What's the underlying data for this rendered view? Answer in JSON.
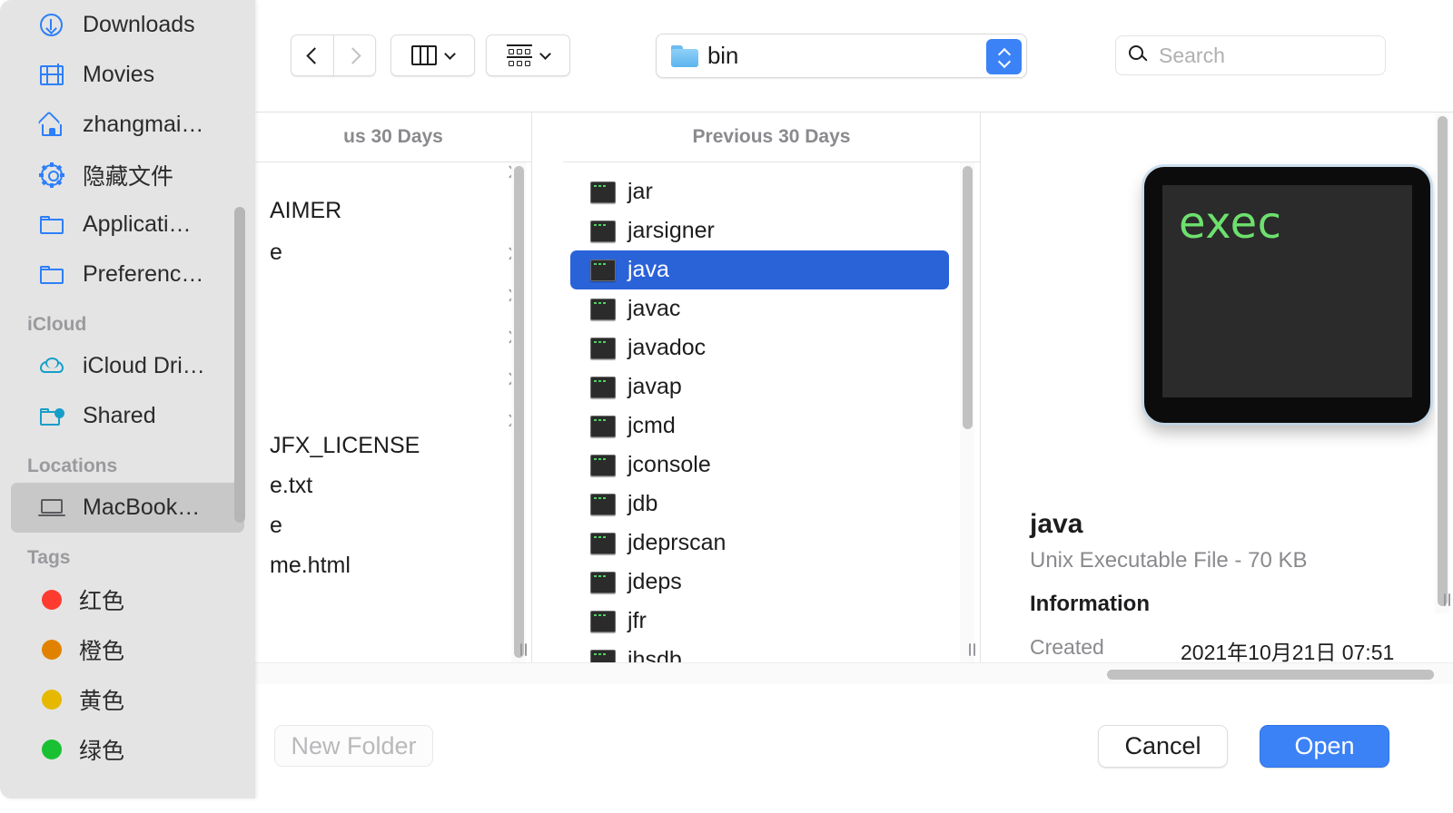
{
  "sidebar": {
    "items": [
      {
        "label": "Downloads",
        "icon": "download-icon"
      },
      {
        "label": "Movies",
        "icon": "movies-icon"
      },
      {
        "label": "zhangmai…",
        "icon": "home-icon"
      },
      {
        "label": "隐藏文件",
        "icon": "gear-icon"
      },
      {
        "label": "Applicati…",
        "icon": "folder-icon"
      },
      {
        "label": "Preferenc…",
        "icon": "folder-icon"
      }
    ],
    "icloud_heading": "iCloud",
    "icloud_items": [
      {
        "label": "iCloud Dri…",
        "icon": "cloud-icon"
      },
      {
        "label": "Shared",
        "icon": "shared-folder-icon"
      }
    ],
    "locations_heading": "Locations",
    "locations_items": [
      {
        "label": "MacBook…",
        "icon": "laptop-icon",
        "selected": true
      }
    ],
    "tags_heading": "Tags",
    "tags": [
      {
        "label": "红色",
        "color": "#ff3b30"
      },
      {
        "label": "橙色",
        "color": "#e08200"
      },
      {
        "label": "黄色",
        "color": "#e6b800"
      },
      {
        "label": "绿色",
        "color": "#19c132"
      }
    ]
  },
  "toolbar": {
    "back_label": "Back",
    "forward_label": "Forward",
    "view_label": "Column View",
    "group_label": "Group By",
    "path_label": "bin",
    "search_placeholder": "Search"
  },
  "browser": {
    "column1": {
      "header": "us 30 Days",
      "rows": [
        {
          "name": "",
          "selected": true,
          "disclosure": true
        },
        {
          "name": "",
          "selected": false,
          "disclosure": true
        },
        {
          "name": "",
          "selected": false,
          "disclosure": true
        },
        {
          "name": "AIMER",
          "selected": false,
          "disclosure": false
        },
        {
          "name": "e",
          "selected": false,
          "disclosure": true
        },
        {
          "name": "",
          "selected": false,
          "disclosure": true
        },
        {
          "name": "",
          "selected": false,
          "disclosure": true
        },
        {
          "name": "",
          "selected": false,
          "disclosure": true
        },
        {
          "name": "",
          "selected": false,
          "disclosure": true
        },
        {
          "name": "JFX_LICENSE",
          "selected": false,
          "disclosure": false
        },
        {
          "name": "e.txt",
          "selected": false,
          "disclosure": false
        },
        {
          "name": "e",
          "selected": false,
          "disclosure": false
        },
        {
          "name": "me.html",
          "selected": false,
          "disclosure": false
        }
      ]
    },
    "column2": {
      "header": "Previous 30 Days",
      "rows": [
        {
          "name": "jar",
          "selected": false
        },
        {
          "name": "jarsigner",
          "selected": false
        },
        {
          "name": "java",
          "selected": true
        },
        {
          "name": "javac",
          "selected": false
        },
        {
          "name": "javadoc",
          "selected": false
        },
        {
          "name": "javap",
          "selected": false
        },
        {
          "name": "jcmd",
          "selected": false
        },
        {
          "name": "jconsole",
          "selected": false
        },
        {
          "name": "jdb",
          "selected": false
        },
        {
          "name": "jdeprscan",
          "selected": false
        },
        {
          "name": "jdeps",
          "selected": false
        },
        {
          "name": "jfr",
          "selected": false
        },
        {
          "name": "jhsdb",
          "selected": false
        }
      ]
    }
  },
  "preview": {
    "thumbnail_text": "exec",
    "title": "java",
    "subtitle": "Unix Executable File - 70 KB",
    "info_header": "Information",
    "created_label": "Created",
    "created_value": "2021年10月21日 07:51"
  },
  "bottom": {
    "new_folder_label": "New Folder",
    "cancel_label": "Cancel",
    "open_label": "Open"
  },
  "colors": {
    "accent": "#3b82f6",
    "selection": "#2a62d8",
    "sidebar_bg": "#e4e4e4"
  }
}
